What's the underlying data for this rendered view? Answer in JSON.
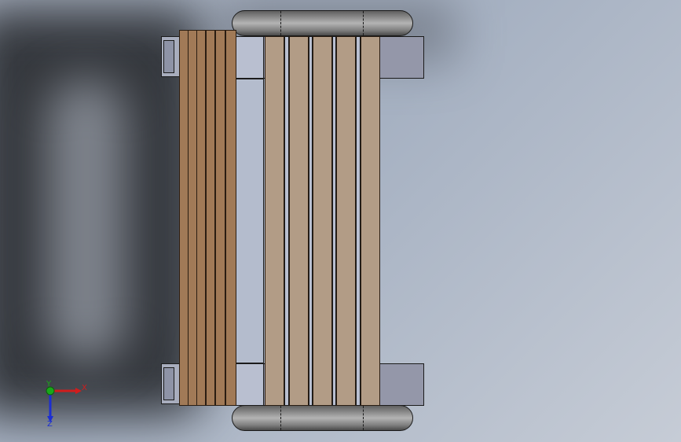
{
  "viewport": {
    "triad": {
      "x_label": "X",
      "y_label": "Y",
      "z_label": "Z",
      "x_color": "#d21c1c",
      "y_color": "#1aa81a",
      "z_color": "#1c2ed2"
    }
  },
  "colors": {
    "background": "#a6b1c2",
    "bracket": "#9497a9",
    "slat_dark": "#a17a57",
    "slat_light": "#b29c86",
    "tube": "#9a9a9a"
  }
}
